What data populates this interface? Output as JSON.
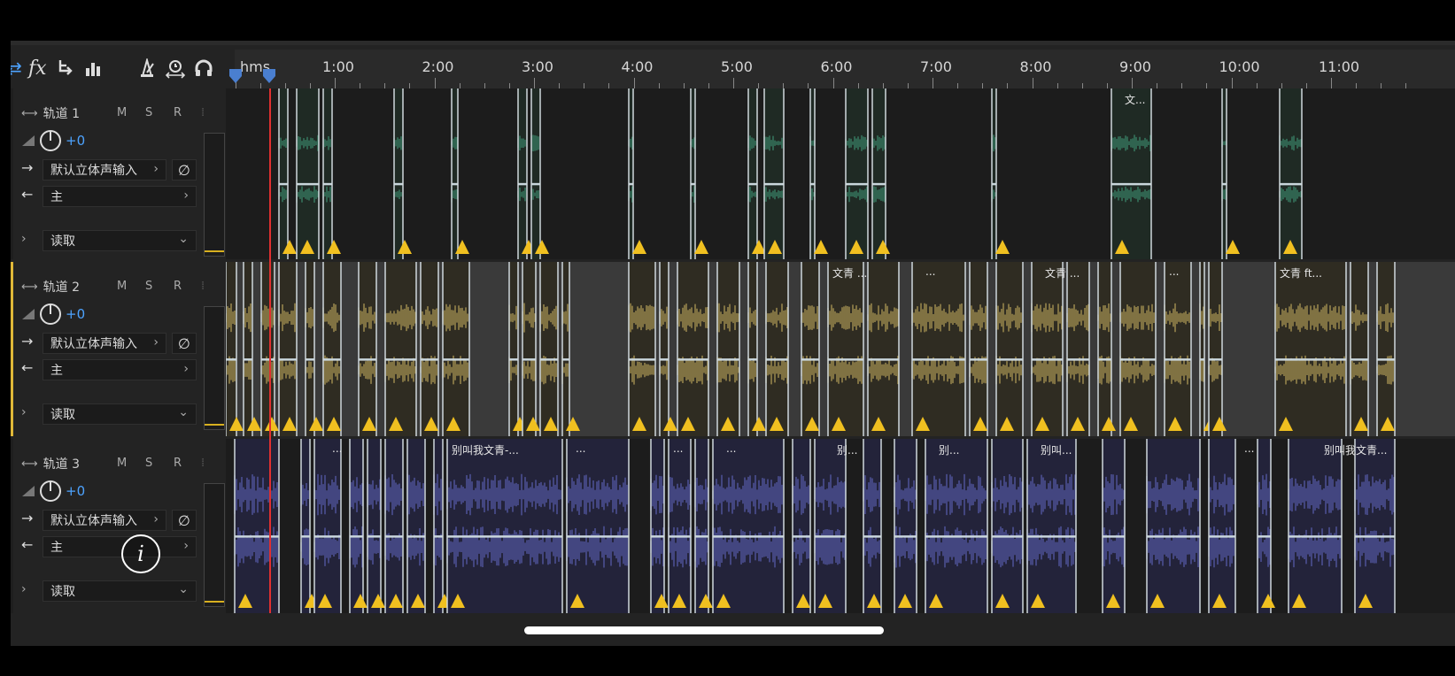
{
  "toolbar": {
    "items": [
      {
        "name": "loop-icon",
        "glyph": "⇄"
      },
      {
        "name": "fx-icon",
        "glyph": "fx"
      },
      {
        "name": "send-icon",
        "glyph": "↳"
      },
      {
        "name": "eq-icon",
        "glyph": "▮▮▮"
      },
      {
        "name": "metronome-icon",
        "glyph": "△"
      },
      {
        "name": "timer-icon",
        "glyph": "◔"
      },
      {
        "name": "headphones-icon",
        "glyph": "∩"
      }
    ]
  },
  "ruler": {
    "unit": "hms",
    "labels": [
      "1:00",
      "2:00",
      "3:00",
      "4:00",
      "5:00",
      "6:00",
      "7:00",
      "8:00",
      "9:00",
      "10:00",
      "11:00"
    ]
  },
  "tracks": [
    {
      "name": "轨道 1",
      "mute": "M",
      "solo": "S",
      "arm": "R",
      "volume": "+0",
      "output": "默认立体声输入",
      "bus": "主",
      "automation": "读取",
      "color": "#3d8c6e",
      "clip_labels": [
        "文..."
      ],
      "accent": "#1e1e1e"
    },
    {
      "name": "轨道 2",
      "mute": "M",
      "solo": "S",
      "arm": "R",
      "volume": "+0",
      "output": "默认立体声输入",
      "bus": "主",
      "automation": "读取",
      "color": "#b8a25a",
      "clip_labels": [
        "文青 ...",
        "...",
        "文青 ...",
        "...",
        "文青 ft..."
      ],
      "accent": "#e0b838"
    },
    {
      "name": "轨道 3",
      "mute": "M",
      "solo": "S",
      "arm": "R",
      "volume": "+0",
      "output": "默认立体声输入",
      "bus": "主",
      "automation": "读取",
      "color": "#5a5fb0",
      "clip_labels": [
        "...",
        "别叫我文青-...",
        "...",
        "...",
        "...",
        "别...",
        "别...",
        "别叫...",
        "...",
        "别叫我文青..."
      ],
      "accent": "#1e1e1e"
    }
  ],
  "colors": {
    "playhead": "#e03030",
    "warning": "#f0c020",
    "marker": "#4a7fd0"
  }
}
